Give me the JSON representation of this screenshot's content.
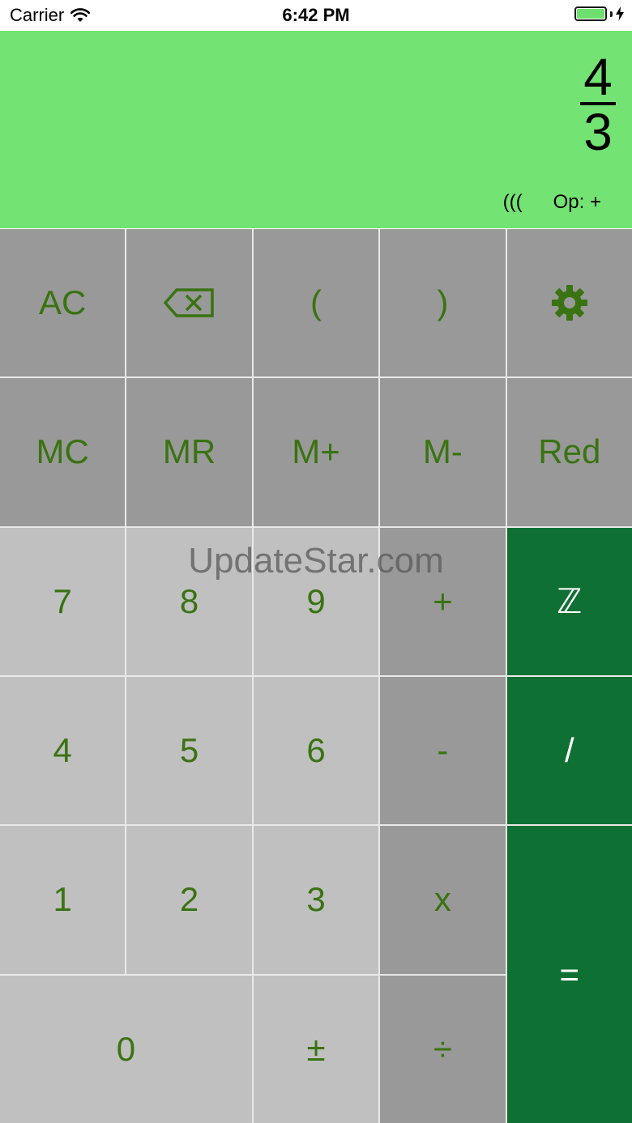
{
  "status_bar": {
    "carrier": "Carrier",
    "time": "6:42 PM",
    "battery_color": "#6ee06e"
  },
  "display": {
    "background": "#73e373",
    "numerator": "4",
    "denominator": "3",
    "parens_indicator": "(((",
    "operation_indicator": "Op: +"
  },
  "colors": {
    "key_text": "#3a7312",
    "accent_key_text": "#ffffff",
    "dark_key": "#999999",
    "light_key": "#c0c0c0",
    "accent_key": "#0f7033",
    "grid_line": "#e9e9e9"
  },
  "keys": {
    "ac": "AC",
    "backspace": "⌫",
    "open_paren": "(",
    "close_paren": ")",
    "settings_icon": "gear-icon",
    "mc": "MC",
    "mr": "MR",
    "m_plus": "M+",
    "m_minus": "M-",
    "red": "Red",
    "seven": "7",
    "eight": "8",
    "nine": "9",
    "plus": "+",
    "integer": "ℤ",
    "four": "4",
    "five": "5",
    "six": "6",
    "minus": "-",
    "fraction_slash": "/",
    "one": "1",
    "two": "2",
    "three": "3",
    "multiply": "x",
    "equals": "=",
    "zero": "0",
    "plus_minus": "±",
    "divide": "÷"
  },
  "watermark": "UpdateStar.com"
}
